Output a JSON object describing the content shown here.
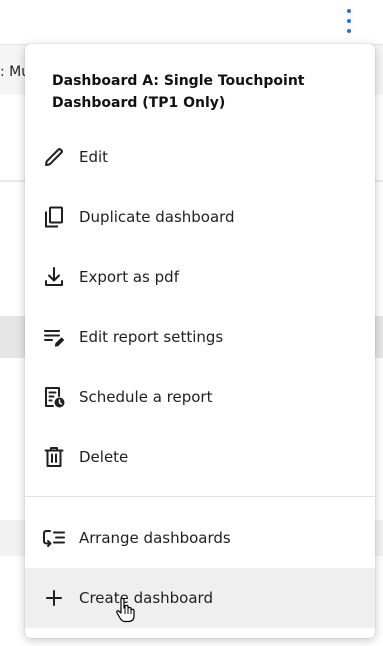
{
  "background": {
    "sub_header_text": ": Mu"
  },
  "menu": {
    "title": "Dashboard A: Single Touchpoint Dashboard (TP1 Only)",
    "items": [
      {
        "label": "Edit",
        "icon": "pencil-icon"
      },
      {
        "label": "Duplicate dashboard",
        "icon": "copy-icon"
      },
      {
        "label": "Export as pdf",
        "icon": "download-icon"
      },
      {
        "label": "Edit report settings",
        "icon": "report-settings-icon"
      },
      {
        "label": "Schedule a report",
        "icon": "schedule-report-icon"
      },
      {
        "label": "Delete",
        "icon": "trash-icon"
      },
      {
        "label": "Arrange dashboards",
        "icon": "arrange-icon"
      },
      {
        "label": "Create dashboard",
        "icon": "plus-icon"
      }
    ]
  },
  "colors": {
    "accent": "#1a73e8",
    "hover_row": "#efefef",
    "text": "#1f1f1f"
  }
}
